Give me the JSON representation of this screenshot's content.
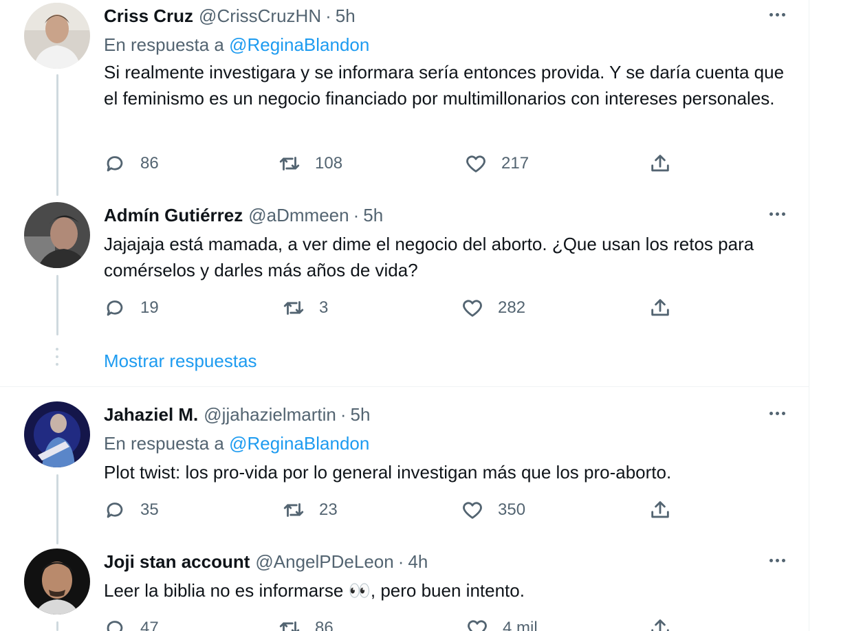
{
  "tweets": [
    {
      "name": "Criss Cruz",
      "handle": "@CrissCruzHN",
      "dot": "·",
      "time": "5h",
      "reply_prefix": "En respuesta a",
      "reply_to": "@ReginaBlandon",
      "text": "Si realmente investigara y se informara sería entonces provida. Y se daría cuenta que el feminismo es un negocio financiado por multimillonarios con intereses personales.",
      "replies": "86",
      "retweets": "108",
      "likes": "217",
      "avatar_color": "#c9c2b8"
    },
    {
      "name": "Admín Gutiérrez",
      "handle": "@aDmmeen",
      "dot": "·",
      "time": "5h",
      "text": "Jajajaja está mamada, a ver dime el negocio del aborto. ¿Que usan los retos para comérselos y darles más años de vida?",
      "replies": "19",
      "retweets": "3",
      "likes": "282",
      "avatar_color": "#5a5a5a"
    },
    {
      "name": "Jahaziel M.",
      "handle": "@jjahazielmartin",
      "dot": "·",
      "time": "5h",
      "reply_prefix": "En respuesta a",
      "reply_to": "@ReginaBlandon",
      "text": "Plot twist: los pro-vida por lo general investigan más que los pro-aborto.",
      "replies": "35",
      "retweets": "23",
      "likes": "350",
      "avatar_color": "#1a1d5c"
    },
    {
      "name": "Joji stan account",
      "handle": "@AngelPDeLeon",
      "dot": "·",
      "time": "4h",
      "text": "Leer la biblia no es informarse 👀, pero buen intento.",
      "replies": "47",
      "retweets": "86",
      "likes": "4 mil",
      "avatar_color": "#2b2b2b"
    }
  ],
  "show_replies": "Mostrar respuestas",
  "icons": {
    "reply": "reply-icon",
    "retweet": "retweet-icon",
    "like": "heart-icon",
    "share": "share-icon",
    "more": "more-icon"
  },
  "colors": {
    "link": "#1d9bf0",
    "secondary": "#536471",
    "thread_line": "#cfd9de"
  }
}
